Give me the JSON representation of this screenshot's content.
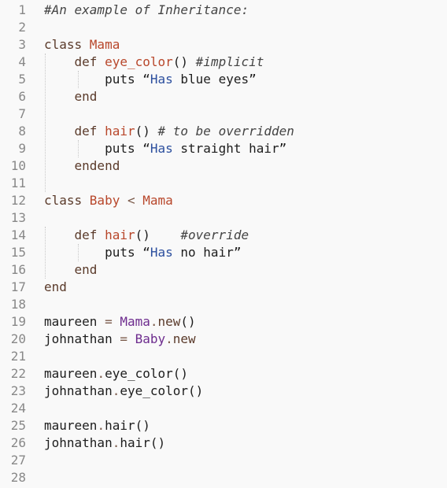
{
  "editor": {
    "language": "ruby",
    "colors": {
      "background": "#f9f9f9",
      "line_number": "#888888",
      "keyword": "#5a3a2a",
      "function_name": "#b8472b",
      "class_name": "#b8472b",
      "comment": "#444444",
      "string_word": "#2c4f9e",
      "constant_call": "#6d2c8e"
    },
    "lines": [
      {
        "n": "1",
        "tokens": [
          {
            "t": "#An example of Inheritance:",
            "c": "cm"
          }
        ]
      },
      {
        "n": "2",
        "tokens": []
      },
      {
        "n": "3",
        "tokens": [
          {
            "t": "class ",
            "c": "kw"
          },
          {
            "t": "Mama",
            "c": "cls"
          }
        ]
      },
      {
        "n": "4",
        "tokens": [
          {
            "t": "    def ",
            "c": "kw"
          },
          {
            "t": "eye_color",
            "c": "fn"
          },
          {
            "t": "() ",
            "c": "plain"
          },
          {
            "t": "#implicit",
            "c": "cm"
          }
        ]
      },
      {
        "n": "5",
        "tokens": [
          {
            "t": "        puts “",
            "c": "plain"
          },
          {
            "t": "Has",
            "c": "str"
          },
          {
            "t": " blue eyes”",
            "c": "plain"
          }
        ]
      },
      {
        "n": "6",
        "tokens": [
          {
            "t": "    end",
            "c": "kw"
          }
        ]
      },
      {
        "n": "7",
        "tokens": []
      },
      {
        "n": "8",
        "tokens": [
          {
            "t": "    def ",
            "c": "kw"
          },
          {
            "t": "hair",
            "c": "fn"
          },
          {
            "t": "() ",
            "c": "plain"
          },
          {
            "t": "# to be overridden",
            "c": "cm"
          }
        ]
      },
      {
        "n": "9",
        "tokens": [
          {
            "t": "        puts “",
            "c": "plain"
          },
          {
            "t": "Has",
            "c": "str"
          },
          {
            "t": " straight hair”",
            "c": "plain"
          }
        ]
      },
      {
        "n": "10",
        "tokens": [
          {
            "t": "    endend",
            "c": "kw"
          }
        ]
      },
      {
        "n": "11",
        "tokens": []
      },
      {
        "n": "12",
        "tokens": [
          {
            "t": "class ",
            "c": "kw"
          },
          {
            "t": "Baby",
            "c": "cls"
          },
          {
            "t": " < ",
            "c": "op"
          },
          {
            "t": "Mama",
            "c": "cls"
          }
        ]
      },
      {
        "n": "13",
        "tokens": []
      },
      {
        "n": "14",
        "tokens": [
          {
            "t": "    def ",
            "c": "kw"
          },
          {
            "t": "hair",
            "c": "fn"
          },
          {
            "t": "()    ",
            "c": "plain"
          },
          {
            "t": "#override",
            "c": "cm"
          }
        ]
      },
      {
        "n": "15",
        "tokens": [
          {
            "t": "        puts “",
            "c": "plain"
          },
          {
            "t": "Has",
            "c": "str"
          },
          {
            "t": " no hair”",
            "c": "plain"
          }
        ]
      },
      {
        "n": "16",
        "tokens": [
          {
            "t": "    end",
            "c": "kw"
          }
        ]
      },
      {
        "n": "17",
        "tokens": [
          {
            "t": "end",
            "c": "kw"
          }
        ]
      },
      {
        "n": "18",
        "tokens": []
      },
      {
        "n": "19",
        "tokens": [
          {
            "t": "maureen ",
            "c": "plain"
          },
          {
            "t": "=",
            "c": "op"
          },
          {
            "t": " ",
            "c": "plain"
          },
          {
            "t": "Mama",
            "c": "const"
          },
          {
            "t": ".",
            "c": "op"
          },
          {
            "t": "new",
            "c": "kw"
          },
          {
            "t": "()",
            "c": "plain"
          }
        ]
      },
      {
        "n": "20",
        "tokens": [
          {
            "t": "johnathan ",
            "c": "plain"
          },
          {
            "t": "=",
            "c": "op"
          },
          {
            "t": " ",
            "c": "plain"
          },
          {
            "t": "Baby",
            "c": "const"
          },
          {
            "t": ".",
            "c": "op"
          },
          {
            "t": "new",
            "c": "kw"
          }
        ]
      },
      {
        "n": "21",
        "tokens": []
      },
      {
        "n": "22",
        "tokens": [
          {
            "t": "maureen",
            "c": "plain"
          },
          {
            "t": ".",
            "c": "op"
          },
          {
            "t": "eye_color()",
            "c": "plain"
          }
        ]
      },
      {
        "n": "23",
        "tokens": [
          {
            "t": "johnathan",
            "c": "plain"
          },
          {
            "t": ".",
            "c": "op"
          },
          {
            "t": "eye_color()",
            "c": "plain"
          }
        ]
      },
      {
        "n": "24",
        "tokens": []
      },
      {
        "n": "25",
        "tokens": [
          {
            "t": "maureen",
            "c": "plain"
          },
          {
            "t": ".",
            "c": "op"
          },
          {
            "t": "hair()",
            "c": "plain"
          }
        ]
      },
      {
        "n": "26",
        "tokens": [
          {
            "t": "johnathan",
            "c": "plain"
          },
          {
            "t": ".",
            "c": "op"
          },
          {
            "t": "hair()",
            "c": "plain"
          }
        ]
      },
      {
        "n": "27",
        "tokens": []
      },
      {
        "n": "28",
        "tokens": []
      }
    ]
  }
}
